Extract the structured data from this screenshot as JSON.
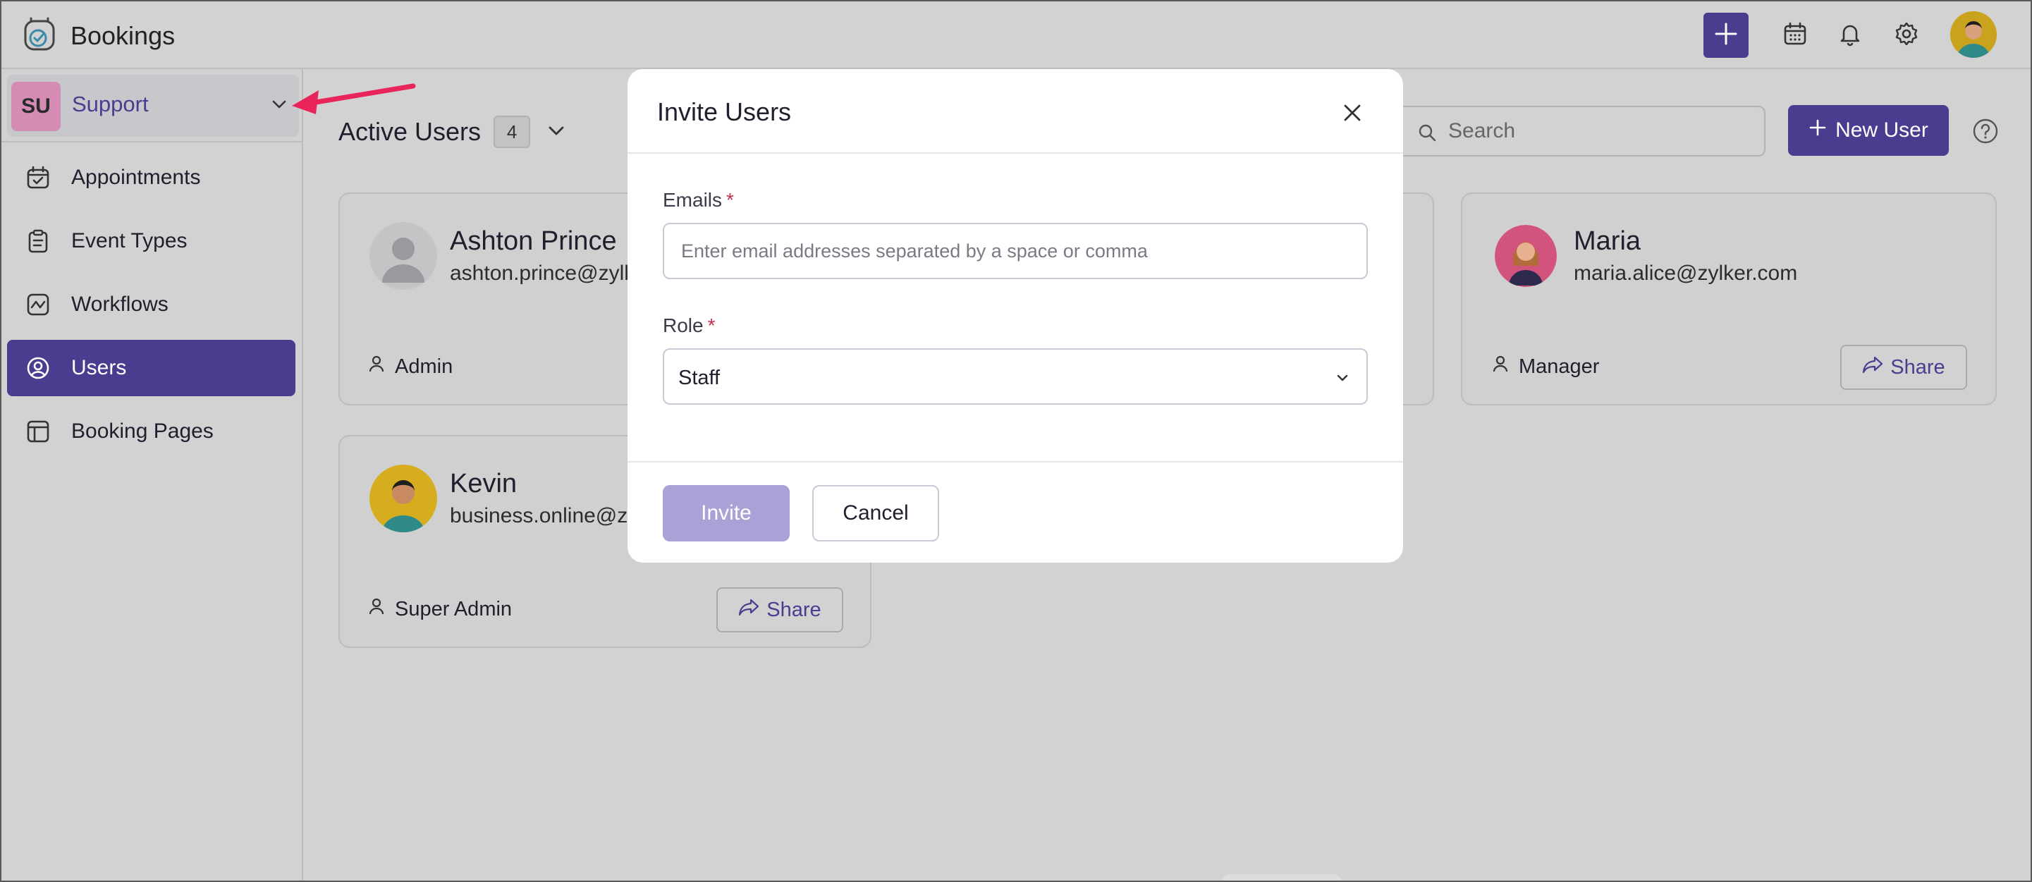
{
  "app": {
    "title": "Bookings"
  },
  "header": {
    "icons": [
      "add-icon",
      "calendar-icon",
      "bell-icon",
      "gear-icon",
      "avatar"
    ]
  },
  "sidebar": {
    "org": {
      "initials": "SU",
      "name": "Support"
    },
    "items": [
      {
        "label": "Appointments",
        "icon": "calendar-check-icon",
        "active": false
      },
      {
        "label": "Event Types",
        "icon": "clipboard-icon",
        "active": false
      },
      {
        "label": "Workflows",
        "icon": "workflow-icon",
        "active": false
      },
      {
        "label": "Users",
        "icon": "user-circle-icon",
        "active": true
      },
      {
        "label": "Booking Pages",
        "icon": "layout-icon",
        "active": false
      }
    ]
  },
  "main": {
    "section_title": "Active Users",
    "count": "4",
    "search": {
      "placeholder": "Search"
    },
    "new_user_label": "New User",
    "cards": [
      {
        "name": "Ashton Prince",
        "email": "ashton.prince@zylk",
        "role": "Admin"
      },
      {
        "name": "Maria",
        "email": "maria.alice@zylker.com",
        "role": "Manager",
        "share_label": "Share"
      },
      {
        "name": "Kevin",
        "email": "business.online@zy",
        "role": "Super Admin",
        "share_label": "Share"
      }
    ]
  },
  "modal": {
    "title": "Invite Users",
    "emails_label": "Emails",
    "required_mark": "*",
    "emails_placeholder": "Enter email addresses separated by a space or comma",
    "role_label": "Role",
    "role_value": "Staff",
    "invite_label": "Invite",
    "cancel_label": "Cancel"
  },
  "colors": {
    "accent": "#4a3d8f",
    "invite_disabled": "#a9a2d6",
    "annotation_arrow": "#e8245a",
    "required": "#c0304a"
  }
}
